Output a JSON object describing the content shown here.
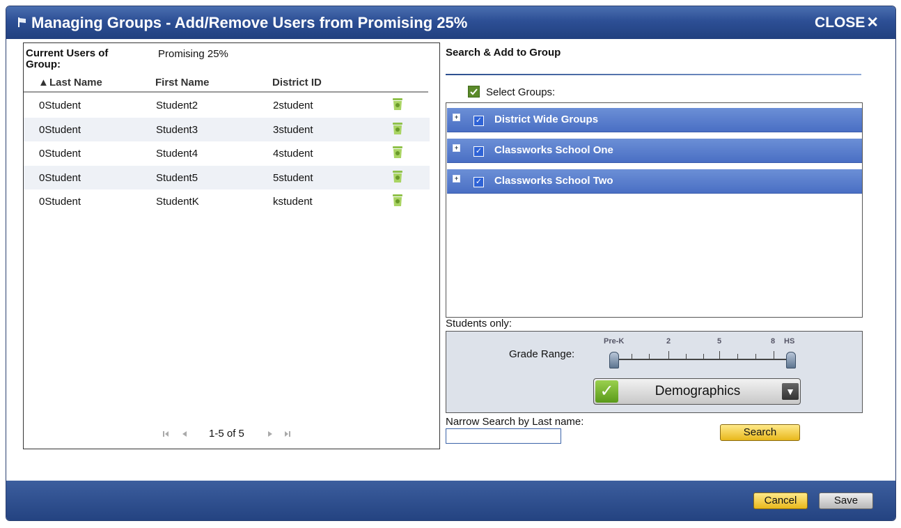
{
  "dialog": {
    "title": "Managing Groups - Add/Remove Users from Promising 25%",
    "close_label": "CLOSE",
    "close_icon": "✕"
  },
  "left": {
    "current_users_label": "Current Users of Group:",
    "group_name": "Promising 25%",
    "columns": {
      "last": "Last Name",
      "first": "First Name",
      "district": "District ID"
    },
    "sort_indicator": "▲",
    "rows": [
      {
        "last": "0Student",
        "first": "Student2",
        "district": "2student"
      },
      {
        "last": "0Student",
        "first": "Student3",
        "district": "3student"
      },
      {
        "last": "0Student",
        "first": "Student4",
        "district": "4student"
      },
      {
        "last": "0Student",
        "first": "Student5",
        "district": "5student"
      },
      {
        "last": "0Student",
        "first": "StudentK",
        "district": "kstudent"
      }
    ],
    "pager_text": "1-5 of 5"
  },
  "right": {
    "search_title": "Search & Add to Group",
    "select_groups_label": "Select Groups:",
    "groups": [
      {
        "label": "District Wide Groups"
      },
      {
        "label": "Classworks School One"
      },
      {
        "label": "Classworks School Two"
      }
    ],
    "students_only_label": "Students only:",
    "grade_range_label": "Grade Range:",
    "grade_ticks": [
      "Pre-K",
      "2",
      "5",
      "8",
      "HS"
    ],
    "grade_range_selected": [
      "Pre-K",
      "HS"
    ],
    "demographics_label": "Demographics",
    "narrow_search_label": "Narrow Search by Last name:",
    "narrow_search_value": "",
    "search_button": "Search"
  },
  "footer": {
    "cancel_button": "Cancel",
    "save_button": "Save"
  },
  "colors": {
    "titlebar": "#2d4f95",
    "group_row": "#5a7fcf",
    "yellow_button": "#f0c93a"
  }
}
